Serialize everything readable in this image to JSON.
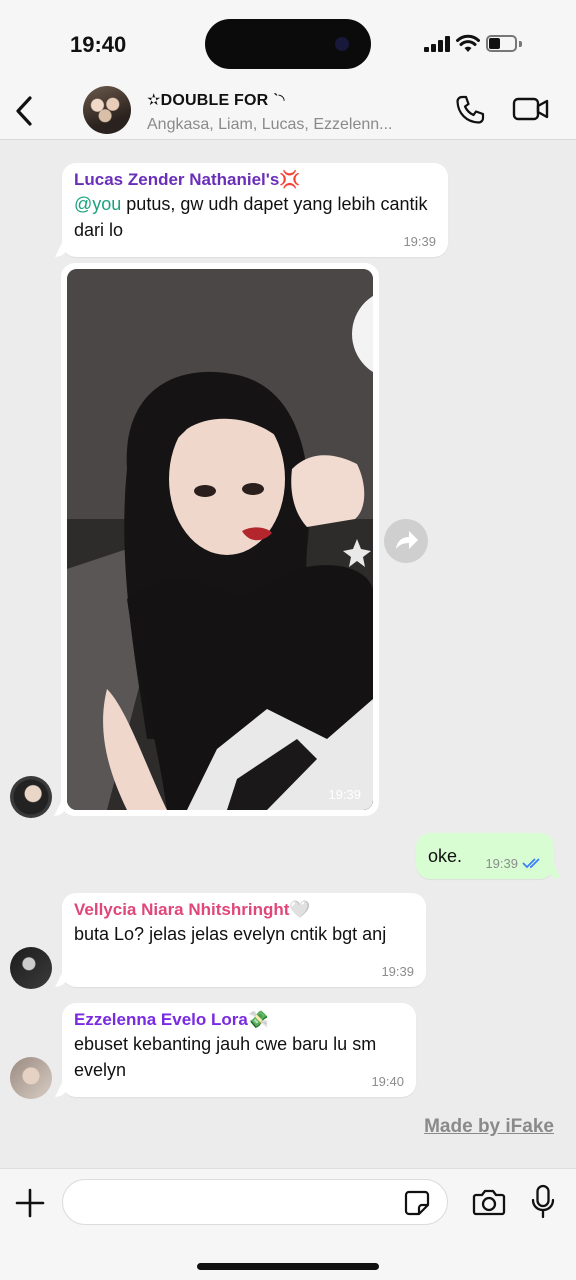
{
  "status": {
    "time": "19:40",
    "battery_level": 0.45
  },
  "header": {
    "group_name": "✫DOUBLE FOR ˋ◝",
    "members": "Angkasa, Liam, Lucas, Ezzelenn..."
  },
  "messages": [
    {
      "sender": "Lucas Zender Nathaniel's💢",
      "sender_color": "#6a2fb8",
      "mention": "@you",
      "text": " putus, gw udh dapet yang lebih cantik dari lo",
      "time": "19:39"
    },
    {
      "type": "photo",
      "time": "19:39"
    },
    {
      "outgoing": true,
      "text": "oke.",
      "time": "19:39",
      "status": "read"
    },
    {
      "sender": "Vellycia Niara Nhitshringht🤍",
      "sender_color": "#e0467a",
      "text": "buta Lo? jelas jelas evelyn cntik bgt anj",
      "time": "19:39"
    },
    {
      "sender": "Ezzelenna Evelo Lora💸",
      "sender_color": "#7a2ae0",
      "text": "ebuset kebanting jauh cwe baru lu sm evelyn",
      "time": "19:40"
    }
  ],
  "watermark": "Made by iFake",
  "input": {
    "placeholder": ""
  },
  "colors": {
    "mention": "#1aa27e",
    "outgoing_bubble": "#d9fdd3",
    "read_ticks": "#3b82f6"
  }
}
